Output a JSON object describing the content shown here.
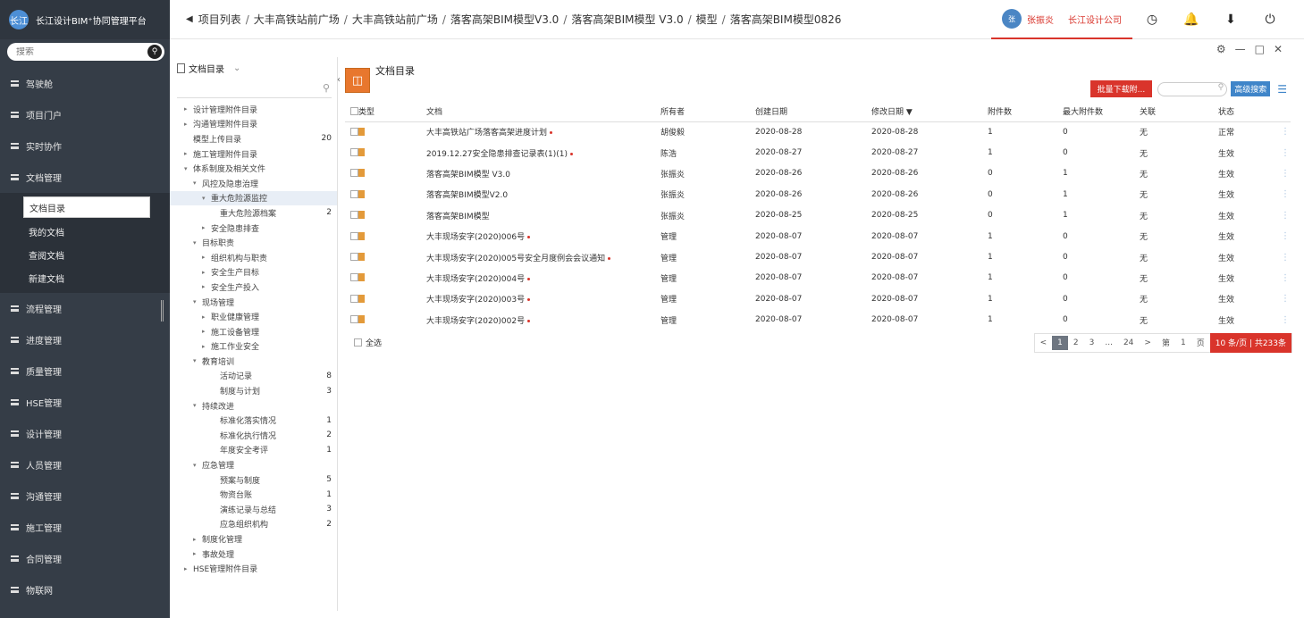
{
  "app": {
    "logo_text": "长江",
    "title": "长江设计BIM⁺协同管理平台"
  },
  "sidebar": {
    "search_placeholder": "搜索",
    "items": [
      {
        "label": "驾驶舱"
      },
      {
        "label": "项目门户"
      },
      {
        "label": "实时协作"
      },
      {
        "label": "文档管理"
      }
    ],
    "subitems": [
      {
        "label": "文档目录",
        "active": true
      },
      {
        "label": "我的文档"
      },
      {
        "label": "查阅文档"
      },
      {
        "label": "新建文档"
      }
    ],
    "items2": [
      {
        "label": "流程管理"
      },
      {
        "label": "进度管理"
      },
      {
        "label": "质量管理"
      },
      {
        "label": "HSE管理"
      },
      {
        "label": "设计管理"
      },
      {
        "label": "人员管理"
      },
      {
        "label": "沟通管理"
      },
      {
        "label": "施工管理"
      },
      {
        "label": "合同管理"
      },
      {
        "label": "物联网"
      }
    ]
  },
  "breadcrumb": [
    "项目列表",
    "大丰高铁站前广场",
    "大丰高铁站前广场",
    "落客高架BIM模型V3.0",
    "落客高架BIM模型 V3.0",
    "模型",
    "落客高架BIM模型0826"
  ],
  "user": {
    "avatar": "张",
    "name": "张振炎",
    "company": "长江设计公司"
  },
  "top_icons": [
    "clock-icon",
    "bell-icon",
    "download-icon",
    "power-icon"
  ],
  "tree": {
    "title": "文档目录",
    "nodes": [
      {
        "label": "设计管理附件目录",
        "indent": 0,
        "arrow": "▸",
        "count": ""
      },
      {
        "label": "沟通管理附件目录",
        "indent": 0,
        "arrow": "▸",
        "count": ""
      },
      {
        "label": "模型上传目录",
        "indent": 0,
        "arrow": "",
        "count": "20"
      },
      {
        "label": "施工管理附件目录",
        "indent": 0,
        "arrow": "▸",
        "count": ""
      },
      {
        "label": "体系制度及相关文件",
        "indent": 0,
        "arrow": "▾",
        "count": ""
      },
      {
        "label": "风控及隐患治理",
        "indent": 1,
        "arrow": "▾",
        "count": ""
      },
      {
        "label": "重大危险源监控",
        "indent": 2,
        "arrow": "▾",
        "count": "",
        "sel": true
      },
      {
        "label": "重大危险源档案",
        "indent": 3,
        "arrow": "",
        "count": "2"
      },
      {
        "label": "安全隐患排查",
        "indent": 2,
        "arrow": "▸",
        "count": ""
      },
      {
        "label": "目标职责",
        "indent": 1,
        "arrow": "▾",
        "count": ""
      },
      {
        "label": "组织机构与职责",
        "indent": 2,
        "arrow": "▸",
        "count": ""
      },
      {
        "label": "安全生产目标",
        "indent": 2,
        "arrow": "▸",
        "count": ""
      },
      {
        "label": "安全生产投入",
        "indent": 2,
        "arrow": "▸",
        "count": ""
      },
      {
        "label": "现场管理",
        "indent": 1,
        "arrow": "▾",
        "count": ""
      },
      {
        "label": "职业健康管理",
        "indent": 2,
        "arrow": "▸",
        "count": ""
      },
      {
        "label": "施工设备管理",
        "indent": 2,
        "arrow": "▸",
        "count": ""
      },
      {
        "label": "施工作业安全",
        "indent": 2,
        "arrow": "▸",
        "count": ""
      },
      {
        "label": "教育培训",
        "indent": 1,
        "arrow": "▾",
        "count": ""
      },
      {
        "label": "活动记录",
        "indent": 3,
        "arrow": "",
        "count": "8"
      },
      {
        "label": "制度与计划",
        "indent": 3,
        "arrow": "",
        "count": "3"
      },
      {
        "label": "持续改进",
        "indent": 1,
        "arrow": "▾",
        "count": ""
      },
      {
        "label": "标准化落实情况",
        "indent": 3,
        "arrow": "",
        "count": "1"
      },
      {
        "label": "标准化执行情况",
        "indent": 3,
        "arrow": "",
        "count": "2"
      },
      {
        "label": "年度安全考评",
        "indent": 3,
        "arrow": "",
        "count": "1"
      },
      {
        "label": "应急管理",
        "indent": 1,
        "arrow": "▾",
        "count": ""
      },
      {
        "label": "预案与制度",
        "indent": 3,
        "arrow": "",
        "count": "5"
      },
      {
        "label": "物资台账",
        "indent": 3,
        "arrow": "",
        "count": "1"
      },
      {
        "label": "演练记录与总结",
        "indent": 3,
        "arrow": "",
        "count": "3"
      },
      {
        "label": "应急组织机构",
        "indent": 3,
        "arrow": "",
        "count": "2"
      },
      {
        "label": "制度化管理",
        "indent": 1,
        "arrow": "▸",
        "count": ""
      },
      {
        "label": "事故处理",
        "indent": 1,
        "arrow": "▸",
        "count": ""
      },
      {
        "label": "HSE管理附件目录",
        "indent": 0,
        "arrow": "▸",
        "count": ""
      }
    ]
  },
  "main": {
    "title": "文档目录",
    "batch_download_label": "批量下载附...",
    "advanced_search_label": "高级搜索",
    "columns": [
      "类型",
      "文档",
      "所有者",
      "创建日期",
      "修改日期 ▼",
      "附件数",
      "最大附件数",
      "关联",
      "状态"
    ],
    "rows": [
      {
        "name": "大丰高铁站广场落客高架进度计划",
        "dot": true,
        "owner": "胡俊毅",
        "created": "2020-08-28",
        "modified": "2020-08-28",
        "att": "1",
        "max": "0",
        "rel": "无",
        "status": "正常"
      },
      {
        "name": "2019.12.27安全隐患排查记录表(1)(1)",
        "dot": true,
        "owner": "陈浩",
        "created": "2020-08-27",
        "modified": "2020-08-27",
        "att": "1",
        "max": "0",
        "rel": "无",
        "status": "生效"
      },
      {
        "name": "落客高架BIM模型 V3.0",
        "dot": false,
        "owner": "张振炎",
        "created": "2020-08-26",
        "modified": "2020-08-26",
        "att": "0",
        "max": "1",
        "rel": "无",
        "status": "生效"
      },
      {
        "name": "落客高架BIM模型V2.0",
        "dot": false,
        "owner": "张振炎",
        "created": "2020-08-26",
        "modified": "2020-08-26",
        "att": "0",
        "max": "1",
        "rel": "无",
        "status": "生效"
      },
      {
        "name": "落客高架BIM模型",
        "dot": false,
        "owner": "张振炎",
        "created": "2020-08-25",
        "modified": "2020-08-25",
        "att": "0",
        "max": "1",
        "rel": "无",
        "status": "生效"
      },
      {
        "name": "大丰现场安字(2020)006号",
        "dot": true,
        "owner": "管理",
        "created": "2020-08-07",
        "modified": "2020-08-07",
        "att": "1",
        "max": "0",
        "rel": "无",
        "status": "生效"
      },
      {
        "name": "大丰现场安字(2020)005号安全月度例会会议通知",
        "dot": true,
        "owner": "管理",
        "created": "2020-08-07",
        "modified": "2020-08-07",
        "att": "1",
        "max": "0",
        "rel": "无",
        "status": "生效"
      },
      {
        "name": "大丰现场安字(2020)004号",
        "dot": true,
        "owner": "管理",
        "created": "2020-08-07",
        "modified": "2020-08-07",
        "att": "1",
        "max": "0",
        "rel": "无",
        "status": "生效"
      },
      {
        "name": "大丰现场安字(2020)003号",
        "dot": true,
        "owner": "管理",
        "created": "2020-08-07",
        "modified": "2020-08-07",
        "att": "1",
        "max": "0",
        "rel": "无",
        "status": "生效"
      },
      {
        "name": "大丰现场安字(2020)002号",
        "dot": true,
        "owner": "管理",
        "created": "2020-08-07",
        "modified": "2020-08-07",
        "att": "1",
        "max": "0",
        "rel": "无",
        "status": "生效"
      }
    ],
    "select_all_label": "全选",
    "pager": {
      "prev": "<",
      "pages": [
        "1",
        "2",
        "3",
        "...",
        "24"
      ],
      "next": ">",
      "goto_prefix": "第",
      "goto_value": "1",
      "goto_suffix": "页",
      "size_label": "10 条/页 | 共233条"
    }
  },
  "colors": {
    "sidebar_bg": "#353d47",
    "accent_red": "#d9342b",
    "accent_blue": "#3f85c9",
    "tile_orange": "#e8772e"
  }
}
